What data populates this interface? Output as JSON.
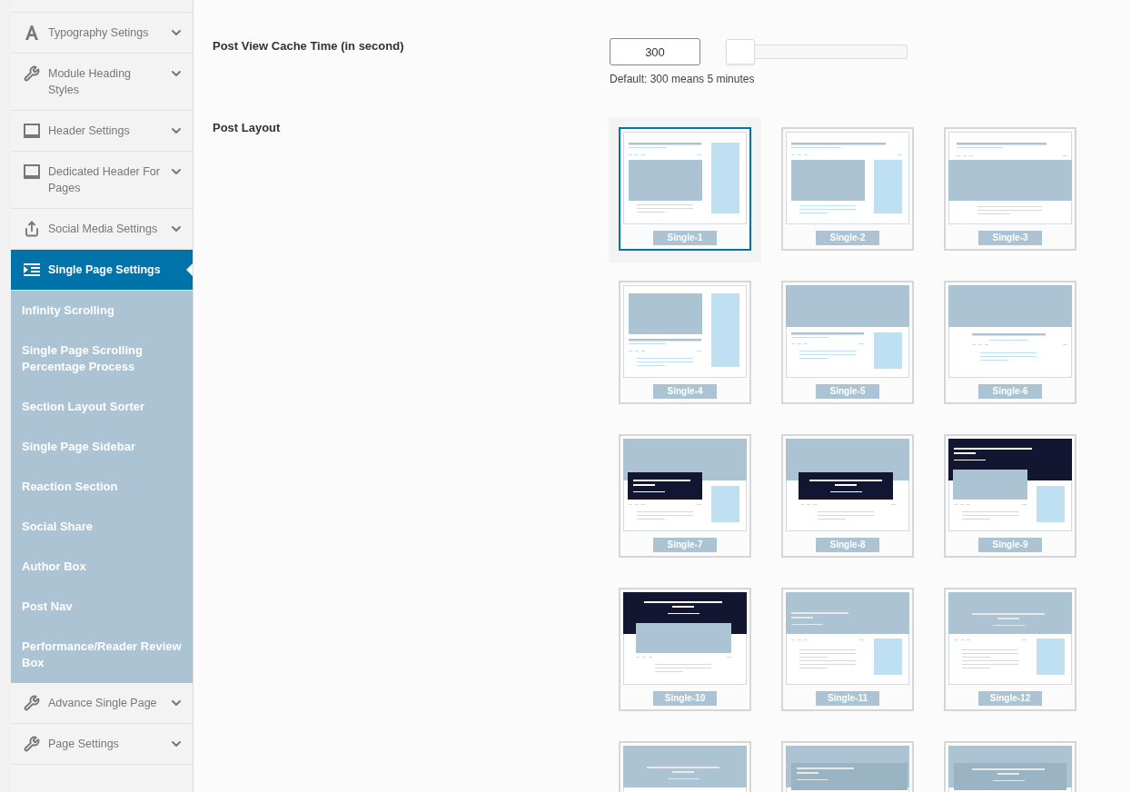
{
  "sidebar": {
    "items": [
      {
        "label": "Typography Setings",
        "kind": "typography",
        "selected": false,
        "expanded": false
      },
      {
        "label": "Module Heading Styles",
        "kind": "wrench",
        "selected": false,
        "expanded": false
      },
      {
        "label": "Header Settings",
        "kind": "header",
        "selected": false,
        "expanded": false
      },
      {
        "label": "Dedicated Header For Pages",
        "kind": "header",
        "selected": false,
        "expanded": false
      },
      {
        "label": "Social Media Settings",
        "kind": "share",
        "selected": false,
        "expanded": false
      },
      {
        "label": "Single Page Settings",
        "kind": "indent",
        "selected": true,
        "expanded": true,
        "children": [
          {
            "label": "Infinity Scrolling"
          },
          {
            "label": "Single Page Scrolling Percentage Process"
          },
          {
            "label": "Section Layout Sorter"
          },
          {
            "label": "Single Page Sidebar"
          },
          {
            "label": "Reaction Section"
          },
          {
            "label": "Social Share"
          },
          {
            "label": "Author Box"
          },
          {
            "label": "Post Nav"
          },
          {
            "label": "Performance/Reader Review Box"
          }
        ]
      },
      {
        "label": "Advance Single Page",
        "kind": "wrench",
        "selected": false,
        "expanded": false
      },
      {
        "label": "Page Settings",
        "kind": "wrench",
        "selected": false,
        "expanded": false
      }
    ]
  },
  "cache_time": {
    "label": "Post View Cache Time (in second)",
    "value": "300",
    "level": 0,
    "hint": "Default: 300 means 5 minutes"
  },
  "post_layout": {
    "label": "Post Layout",
    "layouts": [
      {
        "label": "Single-1",
        "kind": "classic",
        "selected": true
      },
      {
        "label": "Single-2",
        "kind": "classic-low",
        "selected": false
      },
      {
        "label": "Single-3",
        "kind": "wide-image",
        "selected": false
      },
      {
        "label": "Single-4",
        "kind": "image-first",
        "selected": false
      },
      {
        "label": "Single-5",
        "kind": "banner-sidebar",
        "selected": false
      },
      {
        "label": "Single-6",
        "kind": "banner",
        "selected": false
      },
      {
        "label": "Single-7",
        "kind": "overlay-left",
        "selected": false
      },
      {
        "label": "Single-8",
        "kind": "overlay-center",
        "selected": false
      },
      {
        "label": "Single-9",
        "kind": "dark-header-sidebar",
        "selected": false
      },
      {
        "label": "Single-10",
        "kind": "dark-header",
        "selected": false
      },
      {
        "label": "Single-11",
        "kind": "hero-left",
        "selected": false
      },
      {
        "label": "Single-12",
        "kind": "hero-center",
        "selected": false
      },
      {
        "kind": "hero-plain",
        "selected": false
      },
      {
        "kind": "hero-box-left",
        "selected": false
      },
      {
        "kind": "hero-box-center",
        "selected": false
      }
    ]
  }
}
